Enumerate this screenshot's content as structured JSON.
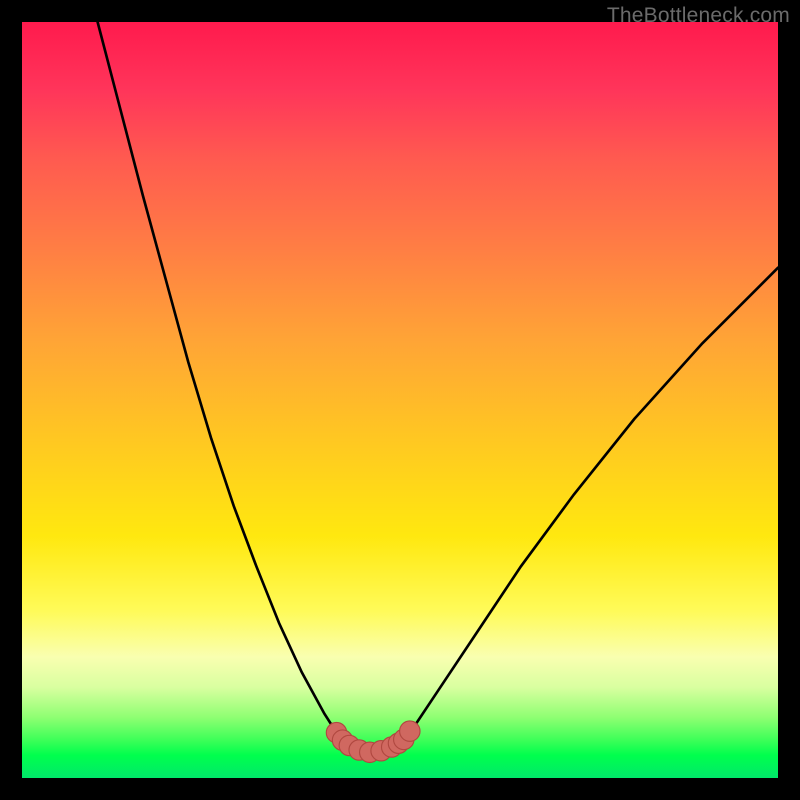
{
  "watermark": "TheBottleneck.com",
  "colors": {
    "background": "#000000",
    "curve_black": "#000000",
    "marker_fill": "#d06860",
    "marker_stroke": "#b04840"
  },
  "chart_data": {
    "type": "line",
    "title": "",
    "xlabel": "",
    "ylabel": "",
    "xlim": [
      0,
      100
    ],
    "ylim": [
      0,
      100
    ],
    "grid": false,
    "legend": false,
    "series": [
      {
        "name": "curve-left",
        "x": [
          10.0,
          13.0,
          16.0,
          19.0,
          22.0,
          25.0,
          28.0,
          31.0,
          34.0,
          37.0,
          40.0,
          41.6,
          42.4
        ],
        "y": [
          100.0,
          88.5,
          77.0,
          66.0,
          55.0,
          45.0,
          36.0,
          28.0,
          20.5,
          14.0,
          8.5,
          6.0,
          5.0
        ]
      },
      {
        "name": "plateau",
        "x": [
          42.4,
          44.5,
          46.5,
          48.5,
          50.5
        ],
        "y": [
          5.0,
          3.6,
          3.3,
          3.6,
          5.0
        ]
      },
      {
        "name": "curve-right",
        "x": [
          50.5,
          52.0,
          55.0,
          60.0,
          66.0,
          73.0,
          81.0,
          90.0,
          100.0
        ],
        "y": [
          5.0,
          7.0,
          11.5,
          19.0,
          28.0,
          37.5,
          47.5,
          57.5,
          67.5
        ]
      }
    ],
    "markers": {
      "name": "transition-markers",
      "x": [
        41.6,
        42.4,
        43.3,
        44.6,
        46.0,
        47.5,
        48.9,
        49.8,
        50.5,
        51.3
      ],
      "y": [
        6.0,
        5.0,
        4.3,
        3.7,
        3.4,
        3.6,
        4.1,
        4.6,
        5.1,
        6.2
      ],
      "r": 1.35
    }
  }
}
